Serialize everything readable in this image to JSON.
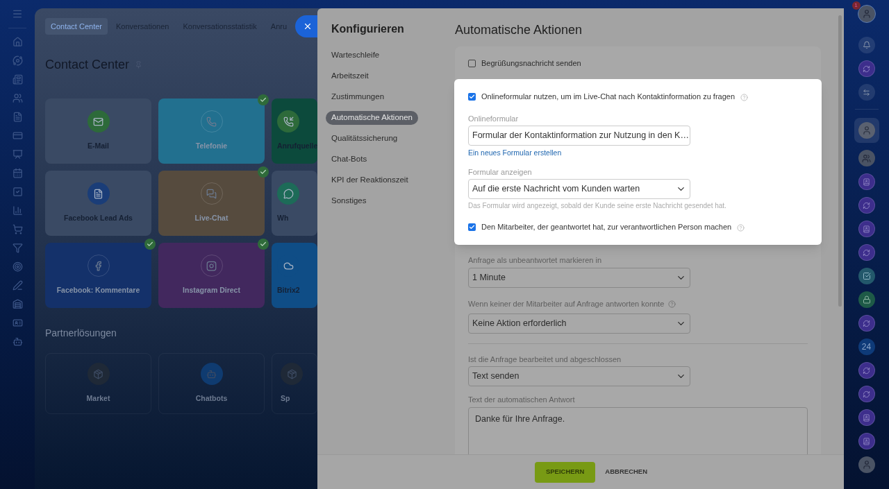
{
  "top_tabs": [
    {
      "label": "Contact Center",
      "selected": true
    },
    {
      "label": "Konversationen",
      "selected": false
    },
    {
      "label": "Konversationsstatistik",
      "selected": false
    },
    {
      "label": "Anru",
      "selected": false
    }
  ],
  "page_title": "Contact Center",
  "channels": [
    {
      "kind": "mail",
      "label": "E-Mail",
      "connected": false,
      "color": "#3a4a64"
    },
    {
      "kind": "phone",
      "label": "Telefonie",
      "connected": true,
      "color": "#22708f"
    },
    {
      "kind": "call-source",
      "label": "Anrufquelle",
      "connected": false,
      "color": "#0c4a3c"
    },
    {
      "kind": "lead-ads",
      "label": "Facebook Lead Ads",
      "connected": false,
      "color": "#3a4a64"
    },
    {
      "kind": "chat",
      "label": "Live-Chat",
      "connected": true,
      "color": "#564b3e"
    },
    {
      "kind": "whatsapp",
      "label": "Wh",
      "connected": false,
      "color": "#3a4a64"
    },
    {
      "kind": "fb-comments",
      "label": "Facebook: Kommentare",
      "connected": true,
      "color": "#14316a"
    },
    {
      "kind": "instagram",
      "label": "Instagram Direct",
      "connected": true,
      "color": "#42285e"
    },
    {
      "kind": "bitrix",
      "label": "Bitrix2",
      "connected": false,
      "color": "#0f4d86"
    }
  ],
  "partner_title": "Partnerlösungen",
  "partners": [
    {
      "kind": "market",
      "label": "Market"
    },
    {
      "kind": "chatbots",
      "label": "Chatbots"
    },
    {
      "kind": "other",
      "label": "Sp"
    }
  ],
  "panel": {
    "title": "Konfigurieren",
    "menu": [
      {
        "label": "Warteschleife",
        "selected": false
      },
      {
        "label": "Arbeitszeit",
        "selected": false
      },
      {
        "label": "Zustimmungen",
        "selected": false
      },
      {
        "label": "Automatische Aktionen",
        "selected": true
      },
      {
        "label": "Qualitätssicherung",
        "selected": false
      },
      {
        "label": "Chat-Bots",
        "selected": false
      },
      {
        "label": "KPI der Reaktionszeit",
        "selected": false
      },
      {
        "label": "Sonstiges",
        "selected": false
      }
    ],
    "heading": "Automatische Aktionen",
    "settings": [
      {
        "kind": "checkbox",
        "label": "Begrüßungsnachricht senden",
        "checked": false,
        "highlighted": false
      },
      {
        "kind": "checkbox",
        "label": "Onlineformular nutzen, um im Live-Chat nach Kontaktinformation zu fragen",
        "checked": true,
        "help": true,
        "highlighted": true
      },
      {
        "kind": "select",
        "label": "Onlineformular",
        "value": "Formular der Kontaktinformation zur Nutzung in den K…",
        "link": "Ein neues Formular erstellen",
        "highlighted": true
      },
      {
        "kind": "select",
        "label": "Formular anzeigen",
        "value": "Auf die erste Nachricht vom Kunden warten",
        "hint": "Das Formular wird angezeigt, sobald der Kunde seine erste Nachricht gesendet hat.",
        "highlighted": true
      },
      {
        "kind": "checkbox",
        "label": "Den Mitarbeiter, der geantwortet hat, zur verantwortlichen Person machen",
        "checked": true,
        "help": true,
        "highlighted": true
      },
      {
        "kind": "select",
        "label": "Anfrage als unbeantwortet markieren in",
        "value": "1 Minute",
        "highlighted": false
      },
      {
        "kind": "select",
        "label": "Wenn keiner der Mitarbeiter auf Anfrage antworten konnte",
        "value": "Keine Aktion erforderlich",
        "help": true,
        "highlighted": false
      },
      {
        "kind": "divider",
        "highlighted": false
      },
      {
        "kind": "select",
        "label": "Ist die Anfrage bearbeitet und abgeschlossen",
        "value": "Text senden",
        "highlighted": false
      },
      {
        "kind": "textarea",
        "label": "Text der automatischen Antwort",
        "value": "Danke für Ihre Anfrage.",
        "highlighted": false
      }
    ],
    "save_button": "SPEICHERN",
    "cancel_button": "ABBRECHEN"
  },
  "right_bar": [
    {
      "kind": "bell"
    },
    {
      "kind": "ring"
    },
    {
      "kind": "exchange"
    },
    {
      "kind": "separator"
    },
    {
      "kind": "avatar-active"
    },
    {
      "kind": "group"
    },
    {
      "kind": "book"
    },
    {
      "kind": "ring"
    },
    {
      "kind": "book"
    },
    {
      "kind": "ring"
    },
    {
      "kind": "task"
    },
    {
      "kind": "lock"
    },
    {
      "kind": "ring"
    },
    {
      "kind": "counter",
      "text": "24"
    },
    {
      "kind": "ring"
    },
    {
      "kind": "ring"
    },
    {
      "kind": "book"
    },
    {
      "kind": "book"
    },
    {
      "kind": "avatar"
    }
  ],
  "user_badge": "1"
}
